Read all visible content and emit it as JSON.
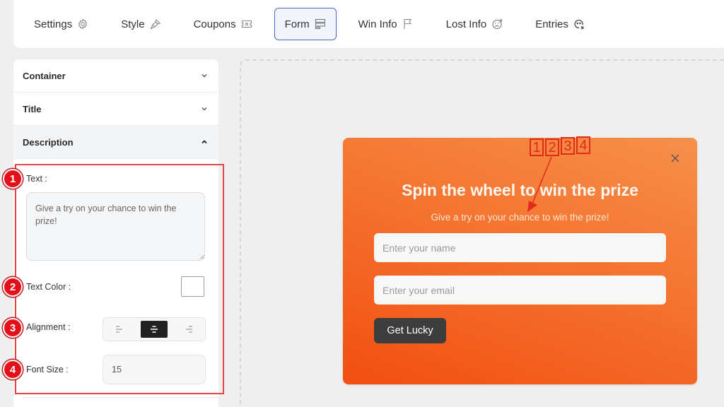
{
  "nav": {
    "tabs": [
      {
        "label": "Settings",
        "icon": "gear-icon",
        "active": false
      },
      {
        "label": "Style",
        "icon": "brush-icon",
        "active": false
      },
      {
        "label": "Coupons",
        "icon": "ticket-icon",
        "active": false
      },
      {
        "label": "Form",
        "icon": "form-rows-icon",
        "active": true
      },
      {
        "label": "Win Info",
        "icon": "flag-icon",
        "active": false
      },
      {
        "label": "Lost Info",
        "icon": "sad-face-icon",
        "active": false
      },
      {
        "label": "Entries",
        "icon": "user-search-icon",
        "active": false
      }
    ]
  },
  "panel": {
    "sections": [
      {
        "label": "Container",
        "expanded": false
      },
      {
        "label": "Title",
        "expanded": false
      },
      {
        "label": "Description",
        "expanded": true
      }
    ],
    "description": {
      "text_label": "Text :",
      "text_value": "Give a try on your chance to win the prize!",
      "text_color_label": "Text Color :",
      "text_color_value": "#ffffff",
      "alignment_label": "Alignment :",
      "alignment_options": [
        "left",
        "center",
        "right"
      ],
      "alignment_selected": "center",
      "font_size_label": "Font Size :",
      "font_size_value": "15"
    }
  },
  "annotations": {
    "badges": [
      "1",
      "2",
      "3",
      "4"
    ],
    "markers": [
      "1",
      "2",
      "3",
      "4"
    ],
    "box_color": "#e04848",
    "badge_color": "#e3101a"
  },
  "preview": {
    "title": "Spin the wheel to win the prize",
    "description": "Give a try on your chance to win the prize!",
    "name_placeholder": "Enter your name",
    "email_placeholder": "Enter your email",
    "button_label": "Get Lucky",
    "gradient_colors": [
      "#f24e12",
      "#f6904a"
    ]
  }
}
